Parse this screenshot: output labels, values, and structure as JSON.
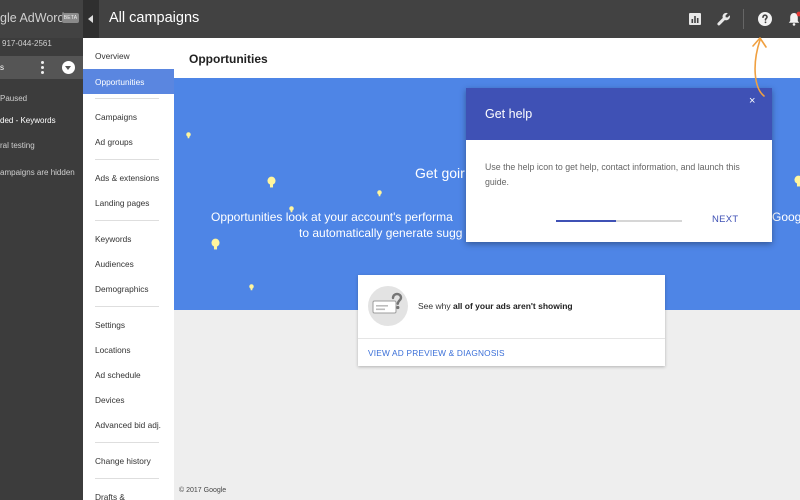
{
  "app": {
    "brand": "gle AdWords",
    "beta_badge": "BETA",
    "page_title": "All campaigns"
  },
  "account": {
    "phone": "917-044-2561",
    "selected": "s"
  },
  "campaigns": [
    {
      "label": "Paused",
      "color": "#cfcfcf"
    },
    {
      "label": "ded - Keywords",
      "color": "#ffffff"
    },
    {
      "label": "ral testing",
      "color": "#cfcfcf"
    },
    {
      "label": "ampaigns are hidden",
      "color": "#cfcfcf"
    }
  ],
  "nav": {
    "items": [
      "Overview",
      "Opportunities",
      "Campaigns",
      "Ad groups",
      "Ads & extensions",
      "Landing pages",
      "Keywords",
      "Audiences",
      "Demographics",
      "Settings",
      "Locations",
      "Ad schedule",
      "Devices",
      "Advanced bid adj.",
      "Change history",
      "Drafts &"
    ],
    "active": "Opportunities"
  },
  "toolbar_icons": [
    "reports-icon",
    "tools-wrench-icon",
    "help-icon",
    "notifications-bell-icon"
  ],
  "main": {
    "section_title": "Opportunities",
    "hero_title": "Get goir",
    "hero_line1": "Opportunities look at your account's performa",
    "hero_line2": "to automatically generate sugg",
    "hero_right": "Googl",
    "card": {
      "text_pre": "See why ",
      "text_bold": "all of your ads aren't showing",
      "link": "VIEW AD PREVIEW & DIAGNOSIS"
    },
    "footer": "© 2017 Google"
  },
  "help_dialog": {
    "title": "Get help",
    "body": "Use the help icon to get help, contact information, and launch this guide.",
    "next": "NEXT",
    "progress": 0.48,
    "close": "×"
  },
  "colors": {
    "topbar": "#424242",
    "hero": "#4e85e6",
    "accent": "#3f51b5",
    "nav_active": "#5a86e0",
    "arrow": "#f0a040"
  }
}
